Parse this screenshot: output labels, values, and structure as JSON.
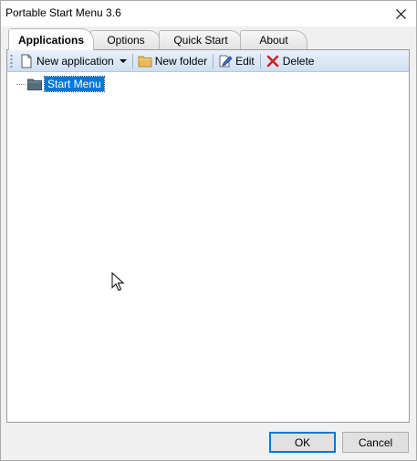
{
  "window": {
    "title": "Portable Start Menu 3.6"
  },
  "tabs": [
    {
      "label": "Applications",
      "active": true
    },
    {
      "label": "Options",
      "active": false
    },
    {
      "label": "Quick Start",
      "active": false
    },
    {
      "label": "About",
      "active": false
    }
  ],
  "toolbar": {
    "new_application": "New application",
    "new_folder": "New folder",
    "edit": "Edit",
    "delete": "Delete"
  },
  "tree": {
    "root_label": "Start Menu",
    "selected": true
  },
  "buttons": {
    "ok": "OK",
    "cancel": "Cancel"
  },
  "icons": {
    "close": "close-icon",
    "new_application": "document-icon",
    "new_folder": "folder-icon",
    "edit": "pencil-icon",
    "delete": "red-x-icon",
    "tree_root": "folder-icon"
  },
  "colors": {
    "selection": "#0078d7",
    "toolbar_top": "#e9f1fb",
    "toolbar_bottom": "#cfdff2",
    "delete_red": "#d42020",
    "folder_yellow": "#e8b955",
    "tree_folder": "#546e7a"
  }
}
